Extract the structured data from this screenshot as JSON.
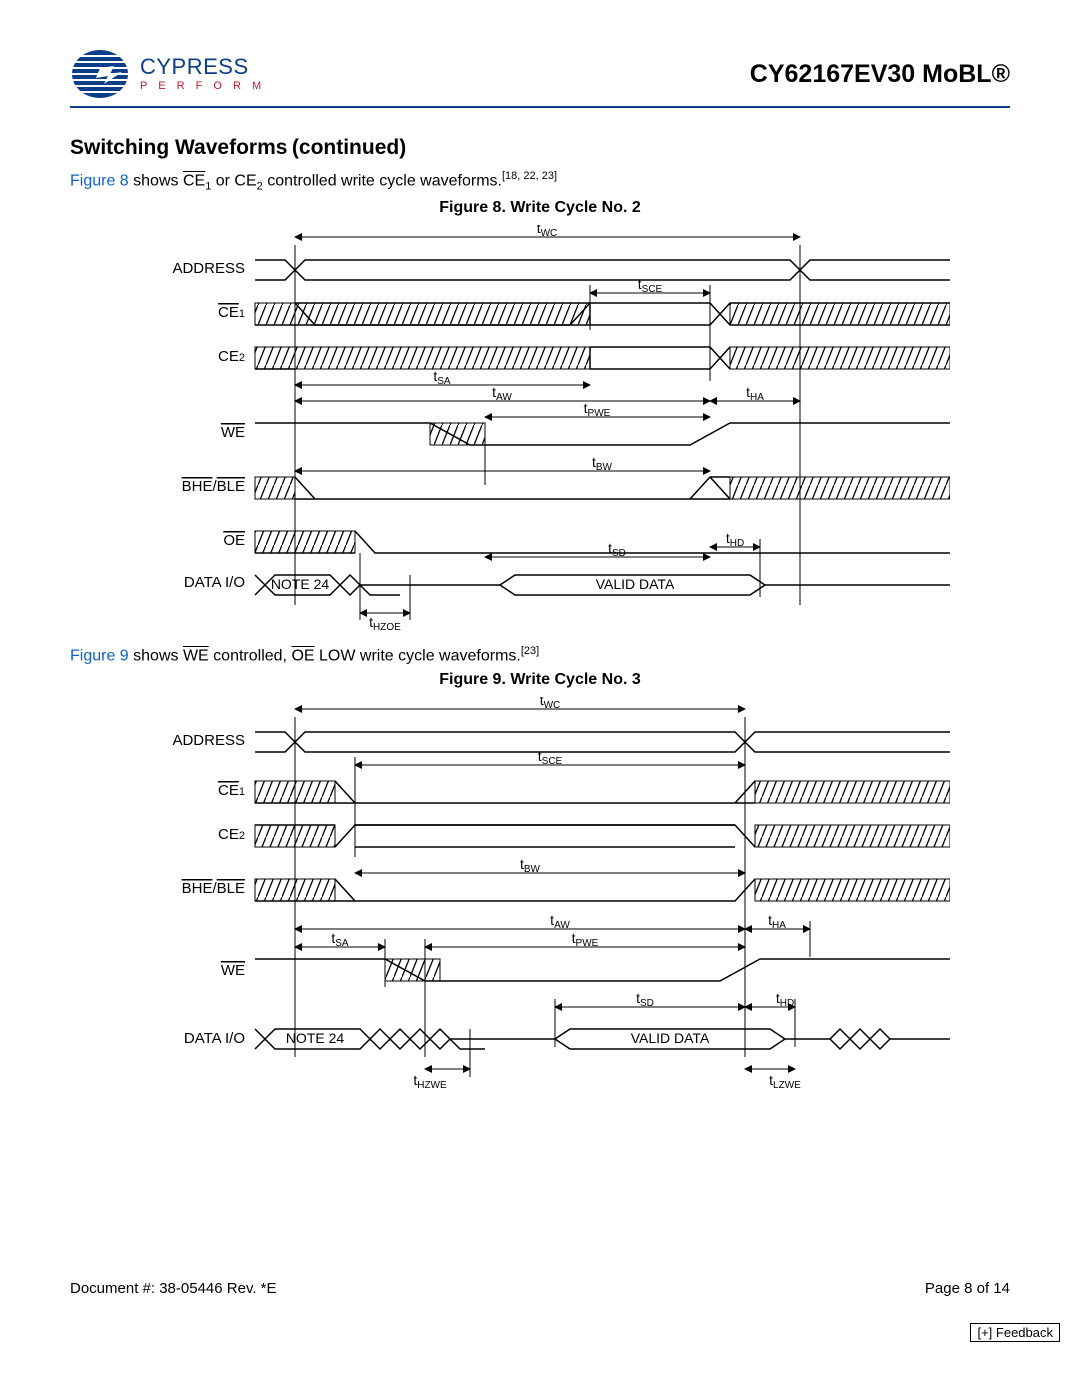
{
  "header": {
    "brand": "CYPRESS",
    "tagline": "P E R F O R M",
    "part": "CY62167EV30 MoBL®"
  },
  "section": {
    "title": "Switching Waveforms",
    "continued": "(continued)"
  },
  "intro1": {
    "figref": "Figure 8",
    "text_before": " shows ",
    "ce1": "CE",
    "ce1_sub": "1",
    "text_mid": " or CE",
    "ce2_sub": "2",
    "text_after": " controlled write cycle waveforms.",
    "refs": "[18, 22, 23]"
  },
  "fig8": {
    "caption": "Figure 8.  Write Cycle No. 2",
    "labels": {
      "ADDRESS": "ADDRESS",
      "CE1": "CE1",
      "CE2": "CE2",
      "WE": "WE",
      "BHE_BLE": "BHE/BLE",
      "OE": "OE",
      "DATA_IO": "DATA I/O"
    },
    "timing": [
      "tWC",
      "tSCE",
      "tSA",
      "tAW",
      "tHA",
      "tPWE",
      "tBW",
      "tSD",
      "tHD",
      "tHZOE"
    ],
    "data_note": "NOTE 24",
    "valid": "VALID DATA"
  },
  "intro2": {
    "figref": "Figure 9",
    "text_before": " shows ",
    "we": "WE",
    "text_mid": " controlled, ",
    "oe": "OE",
    "text_after": " LOW write cycle waveforms.",
    "refs": "[23]"
  },
  "fig9": {
    "caption": "Figure 9.  Write Cycle No. 3",
    "labels": {
      "ADDRESS": "ADDRESS",
      "CE1": "CE1",
      "CE2": "CE2",
      "BHE_BLE": "BHE/BLE",
      "WE": "WE",
      "DATA_IO": "DATA I/O"
    },
    "timing": [
      "tWC",
      "tSCE",
      "tBW",
      "tAW",
      "tHA",
      "tSA",
      "tPWE",
      "tSD",
      "tHD",
      "tHZWE",
      "tLZWE"
    ],
    "data_note": "NOTE 24",
    "valid": "VALID DATA"
  },
  "footer": {
    "doc": "Document #: 38-05446 Rev. *E",
    "page": "Page 8 of 14",
    "feedback": "[+] Feedback"
  }
}
